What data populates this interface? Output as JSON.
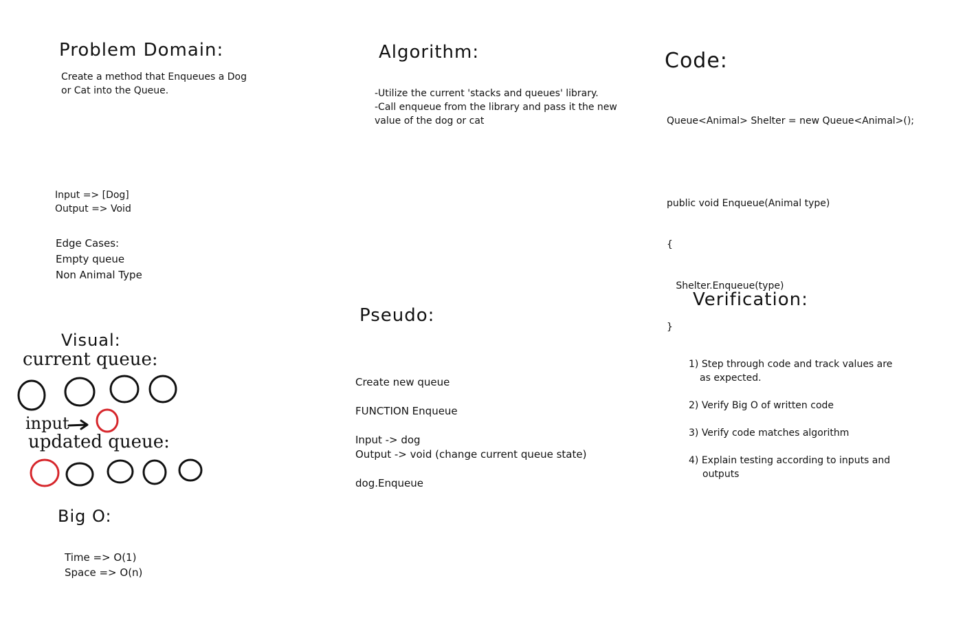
{
  "problem_domain": {
    "title": "Problem Domain:",
    "description_lines": [
      "Create a method that Enqueues a Dog",
      "or Cat into the Queue."
    ],
    "io_lines": [
      "Input => [Dog]",
      "Output => Void"
    ],
    "edge_cases_title": "Edge Cases:",
    "edge_cases": [
      "Empty queue",
      "Non Animal Type"
    ]
  },
  "algorithm": {
    "title": "Algorithm:",
    "lines": [
      "-Utilize the current 'stacks and queues' library.",
      "-Call enqueue from the library and pass it the new",
      "value of the dog or cat"
    ]
  },
  "code": {
    "title": "Code:",
    "lines": [
      "Queue<Animal> Shelter = new Queue<Animal>();",
      "",
      "public void Enqueue(Animal type)",
      "{",
      "   Shelter.Enqueue(type)",
      "}"
    ]
  },
  "visual": {
    "title": "Visual:",
    "current_label": "current queue:",
    "input_label": "input",
    "updated_label": "updated queue:",
    "current_queue_count": 4,
    "updated_queue_count": 5,
    "highlight_color": "#d6262b",
    "ink_color": "#111111"
  },
  "big_o": {
    "title": "Big O:",
    "lines": [
      "Time => O(1)",
      "Space => O(n)"
    ]
  },
  "pseudo": {
    "title": "Pseudo:",
    "lines": [
      "Create new queue",
      "",
      "FUNCTION Enqueue",
      "",
      "Input -> dog",
      "Output -> void (change current queue state)",
      "",
      "dog.Enqueue"
    ]
  },
  "verification": {
    "title": "Verification:",
    "items": [
      {
        "line1": "1) Step through code and track values are",
        "line2": "as expected."
      },
      {
        "line1": "2) Verify Big O of written code",
        "line2": ""
      },
      {
        "line1": "3) Verify code matches algorithm",
        "line2": ""
      },
      {
        "line1": "4) Explain testing according to inputs and",
        "line2": "outputs"
      }
    ]
  }
}
